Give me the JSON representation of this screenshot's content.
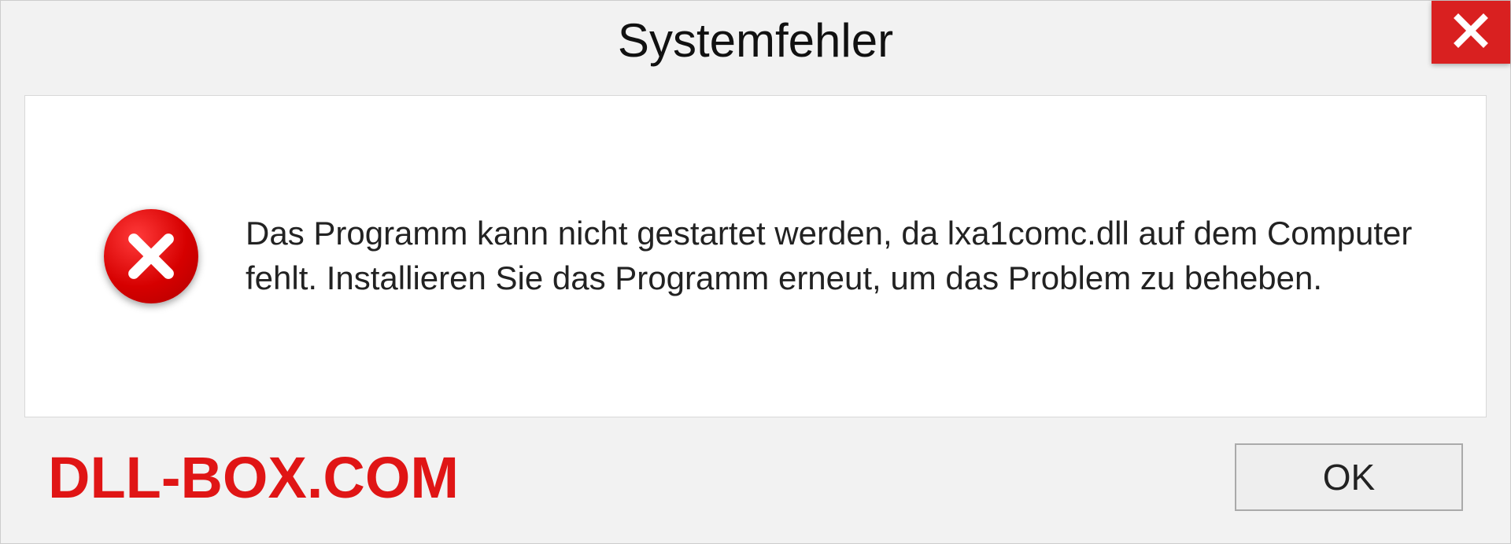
{
  "titlebar": {
    "title": "Systemfehler",
    "close_icon": "close-icon"
  },
  "content": {
    "error_icon": "error-circle-icon",
    "message": "Das Programm kann nicht gestartet werden, da lxa1comc.dll auf dem Computer fehlt. Installieren Sie das Programm erneut, um das Problem zu beheben."
  },
  "footer": {
    "watermark": "DLL-BOX.COM",
    "ok_label": "OK"
  }
}
